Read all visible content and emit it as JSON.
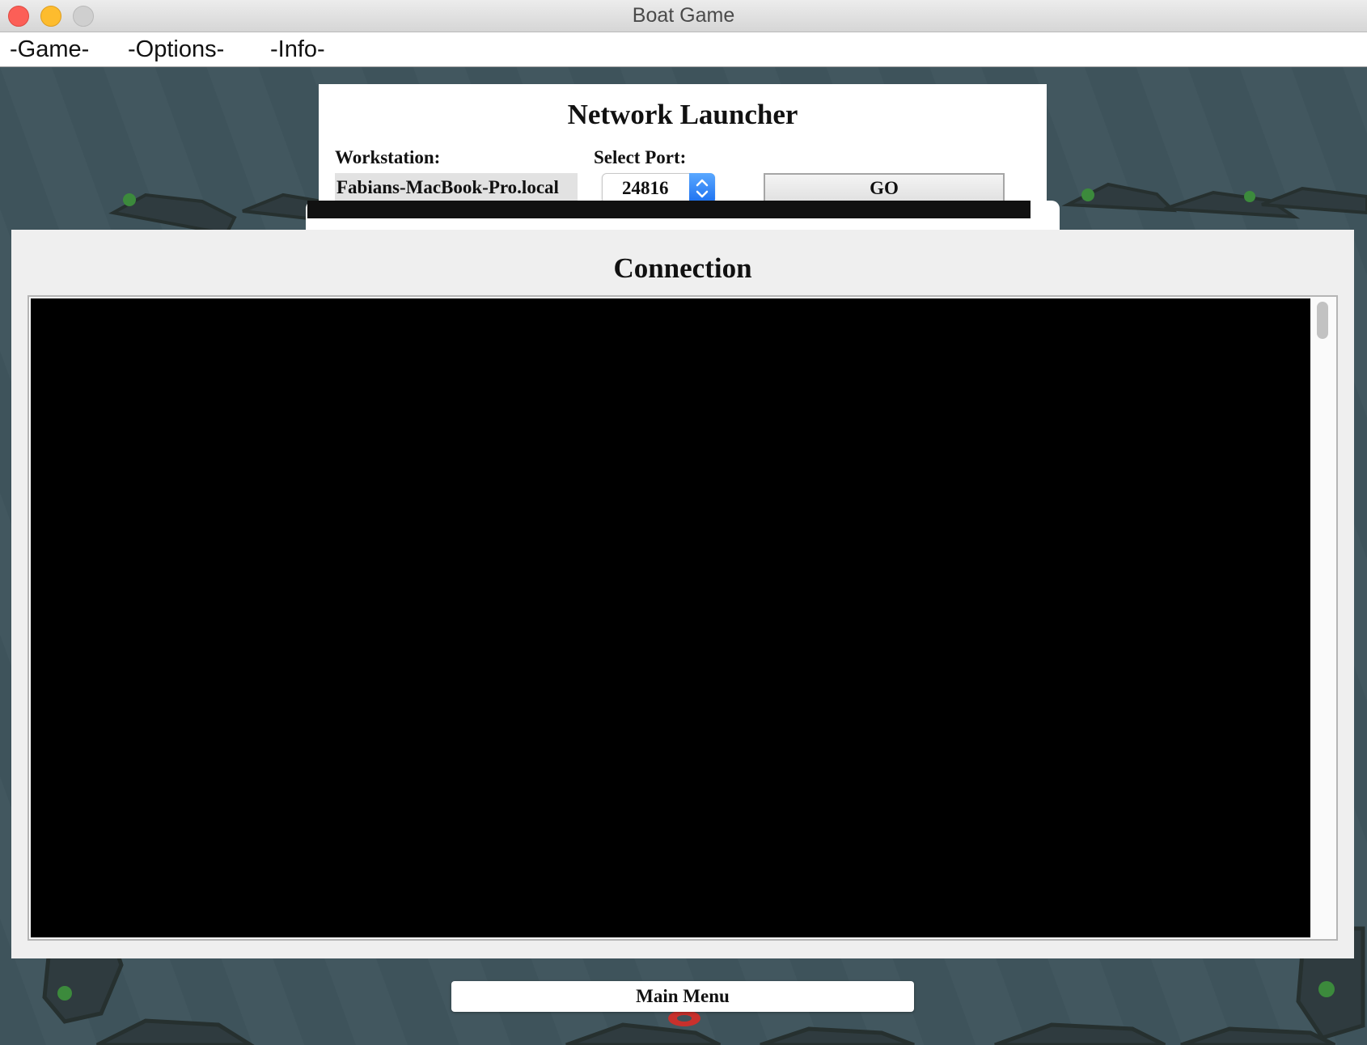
{
  "window": {
    "title": "Boat Game"
  },
  "menubar": {
    "items": [
      {
        "label": "-Game-"
      },
      {
        "label": "-Options-"
      },
      {
        "label": "-Info-"
      }
    ]
  },
  "launcher": {
    "title": "Network Launcher",
    "workstation_label": "Workstation:",
    "workstation_value": "Fabians-MacBook-Pro.local",
    "port_label": "Select Port:",
    "port_value": "24816",
    "go_label": "GO"
  },
  "connection": {
    "title": "Connection",
    "log_text": ""
  },
  "footer": {
    "main_menu_label": "Main Menu"
  },
  "colors": {
    "water": "#3e535b",
    "rock": "#2f3b3f",
    "moss": "#3c8a3c",
    "console": "#000000",
    "spinner_accent": "#1a6ff0"
  }
}
